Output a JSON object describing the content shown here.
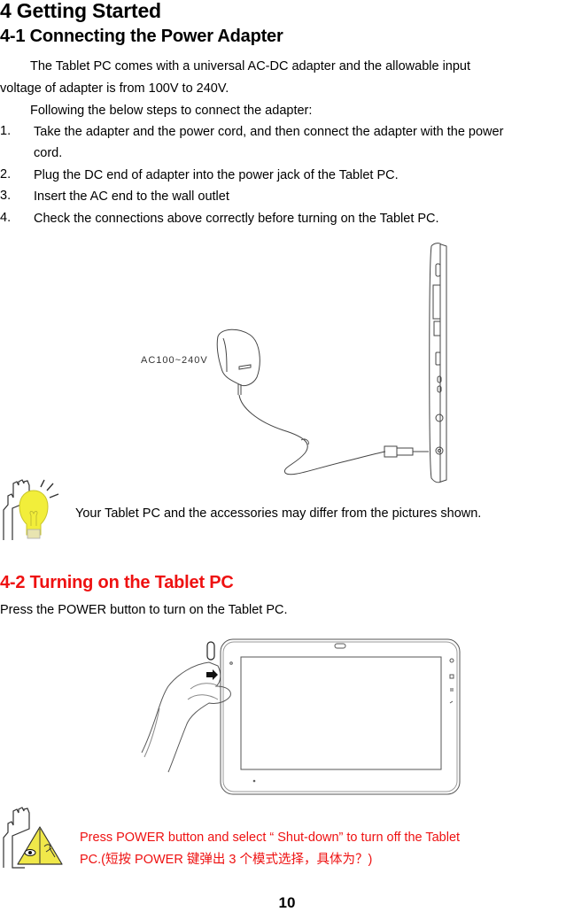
{
  "document": {
    "chapter_title": "4 Getting Started",
    "section_1": {
      "title": "4-1 Connecting the Power Adapter",
      "intro_line1": "The Tablet PC comes with a universal AC-DC adapter and the allowable input",
      "intro_line2": "voltage of adapter is from 100V to 240V.",
      "steps_intro": "Following the below steps to connect the adapter:",
      "steps": [
        {
          "num": "1.",
          "line1": "Take the adapter and the power cord, and then connect the adapter with the power",
          "line2": "cord."
        },
        {
          "num": "2.",
          "line1": "Plug the DC end of adapter into the power jack of the Tablet PC."
        },
        {
          "num": "3.",
          "line1": "Insert the AC end to the wall outlet"
        },
        {
          "num": "4.",
          "line1": "Check the connections above correctly before turning on the Tablet PC."
        }
      ],
      "figure_label": "AC100~240V",
      "note": "Your Tablet PC and the accessories may differ from the pictures shown."
    },
    "section_2": {
      "title": "4-2 Turning on the Tablet PC",
      "body": "Press the POWER button to turn on the Tablet PC.",
      "warning_line1": "Press POWER button and select “ Shut-down”  to turn off the Tablet",
      "warning_line2": "PC.(短按 POWER 键弹出 3 个模式选择，具体为？)"
    },
    "page_number": "10"
  },
  "colors": {
    "heading_red": "#ee1111",
    "bulb_yellow": "#f2ee3a",
    "warning_yellow": "#f0e84a"
  }
}
